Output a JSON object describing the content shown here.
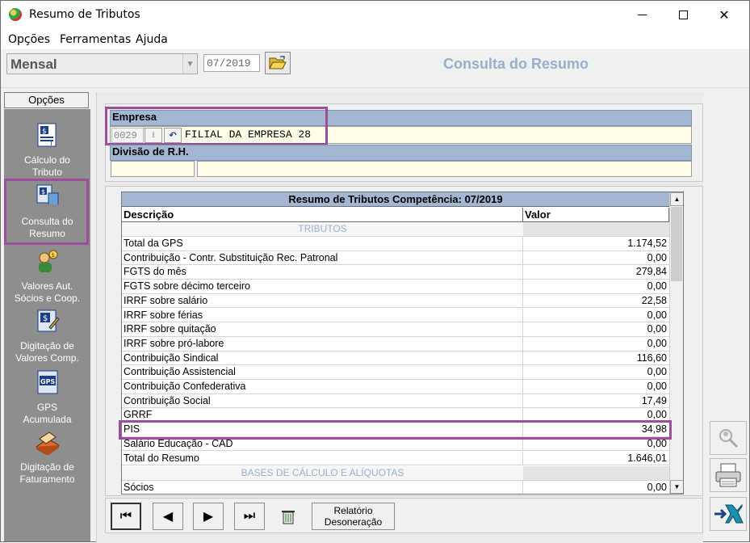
{
  "window": {
    "title": "Resumo de Tributos"
  },
  "menu": [
    "Opções",
    "Ferramentas",
    "Ajuda"
  ],
  "toolbar": {
    "type_value": "Mensal",
    "period": "07/2019",
    "header_title": "Consulta do Resumo"
  },
  "sidebar": {
    "tab": "Opções",
    "items": [
      {
        "label1": "Cálculo do",
        "label2": "Tributo",
        "icon": "calc-tributo-icon"
      },
      {
        "label1": "Consulta do",
        "label2": "Resumo",
        "icon": "consulta-resumo-icon"
      },
      {
        "label1": "Valores Aut.",
        "label2": "Sócios e  Coop.",
        "icon": "valores-socios-icon"
      },
      {
        "label1": "Digitação de",
        "label2": "Valores Comp.",
        "icon": "digitacao-valores-icon"
      },
      {
        "label1": "GPS",
        "label2": "Acumulada",
        "icon": "gps-icon"
      },
      {
        "label1": "Digitação de",
        "label2": "Faturamento",
        "icon": "faturamento-icon"
      }
    ]
  },
  "empresa": {
    "label": "Empresa",
    "code": "0029",
    "name": "FILIAL DA EMPRESA 28"
  },
  "divisao": {
    "label": "Divisão de R.H."
  },
  "grid": {
    "title": "Resumo de Tributos Competência: 07/2019",
    "col_desc": "Descrição",
    "col_valor": "Valor",
    "section1": "TRIBUTOS",
    "section2": "BASES DE CÁLCULO E ALÍQUOTAS",
    "rows": [
      {
        "desc": "Total da GPS",
        "val": "1.174,52"
      },
      {
        "desc": "Contribuição - Contr. Substituição Rec. Patronal",
        "val": "0,00"
      },
      {
        "desc": "FGTS do mês",
        "val": "279,84"
      },
      {
        "desc": "FGTS sobre décimo terceiro",
        "val": "0,00"
      },
      {
        "desc": "IRRF sobre salário",
        "val": "22,58"
      },
      {
        "desc": "IRRF sobre férias",
        "val": "0,00"
      },
      {
        "desc": "IRRF sobre quitação",
        "val": "0,00"
      },
      {
        "desc": "IRRF sobre pró-labore",
        "val": "0,00"
      },
      {
        "desc": "Contribuição Sindical",
        "val": "116,60"
      },
      {
        "desc": "Contribuição Assistencial",
        "val": "0,00"
      },
      {
        "desc": "Contribuição Confederativa",
        "val": "0,00"
      },
      {
        "desc": "Contribuição Social",
        "val": "17,49"
      },
      {
        "desc": "GRRF",
        "val": "0,00"
      },
      {
        "desc": "PIS",
        "val": "34,98"
      },
      {
        "desc": "Salário Educação - CAD",
        "val": "0,00"
      },
      {
        "desc": "Total do Resumo",
        "val": "1.646,01"
      }
    ],
    "after_rows": [
      {
        "desc": "Sócios",
        "val": "0,00"
      }
    ]
  },
  "nav": {
    "relatorio1": "Relatório",
    "relatorio2": "Desoneração"
  },
  "colors": {
    "highlight": "#9b4f9b",
    "header_blue": "#a3b7d3",
    "title_blue": "#9aaecb"
  }
}
